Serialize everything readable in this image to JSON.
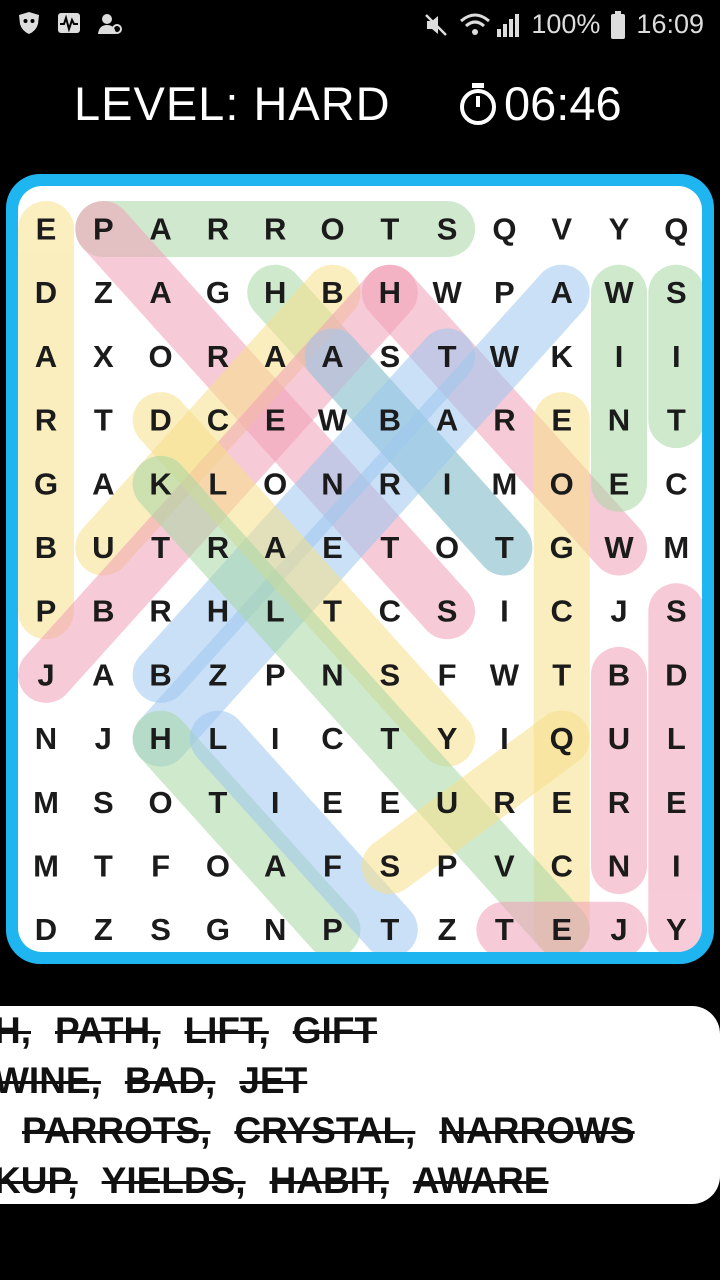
{
  "status": {
    "battery": "100%",
    "time": "16:09"
  },
  "header": {
    "level": "LEVEL: HARD",
    "timer": "06:46"
  },
  "grid": [
    [
      "E",
      "P",
      "A",
      "R",
      "R",
      "O",
      "T",
      "S",
      "Q",
      "V",
      "Y",
      "Q"
    ],
    [
      "D",
      "Z",
      "A",
      "G",
      "H",
      "B",
      "H",
      "W",
      "P",
      "A",
      "W",
      "S"
    ],
    [
      "A",
      "X",
      "O",
      "R",
      "A",
      "A",
      "S",
      "T",
      "W",
      "K",
      "I",
      "I"
    ],
    [
      "R",
      "T",
      "D",
      "C",
      "E",
      "W",
      "B",
      "A",
      "R",
      "E",
      "N",
      "T"
    ],
    [
      "G",
      "A",
      "K",
      "L",
      "O",
      "N",
      "R",
      "I",
      "M",
      "O",
      "E",
      "C"
    ],
    [
      "B",
      "U",
      "T",
      "R",
      "A",
      "E",
      "T",
      "O",
      "T",
      "G",
      "W",
      "M"
    ],
    [
      "P",
      "B",
      "R",
      "H",
      "L",
      "T",
      "C",
      "S",
      "I",
      "C",
      "J",
      "S"
    ],
    [
      "J",
      "A",
      "B",
      "Z",
      "P",
      "N",
      "S",
      "F",
      "W",
      "T",
      "B",
      "D"
    ],
    [
      "N",
      "J",
      "H",
      "L",
      "I",
      "C",
      "T",
      "Y",
      "I",
      "Q",
      "U",
      "L"
    ],
    [
      "M",
      "S",
      "O",
      "T",
      "I",
      "E",
      "E",
      "U",
      "R",
      "E",
      "R",
      "E"
    ],
    [
      "M",
      "T",
      "F",
      "O",
      "A",
      "F",
      "S",
      "P",
      "V",
      "C",
      "N",
      "I"
    ],
    [
      "D",
      "Z",
      "S",
      "G",
      "N",
      "P",
      "T",
      "Z",
      "T",
      "E",
      "J",
      "Y"
    ]
  ],
  "highlights": [
    {
      "from": [
        0,
        0
      ],
      "to": [
        6,
        0
      ],
      "color": "#f7e08a"
    },
    {
      "from": [
        0,
        1
      ],
      "to": [
        0,
        7
      ],
      "color": "#a9d8a6"
    },
    {
      "from": [
        0,
        1
      ],
      "to": [
        6,
        7
      ],
      "color": "#f2a0b8"
    },
    {
      "from": [
        1,
        4
      ],
      "to": [
        5,
        8
      ],
      "color": "#a9d8a6"
    },
    {
      "from": [
        1,
        5
      ],
      "to": [
        5,
        1
      ],
      "color": "#f7e08a"
    },
    {
      "from": [
        1,
        6
      ],
      "to": [
        7,
        0
      ],
      "color": "#f2a0b8"
    },
    {
      "from": [
        1,
        6
      ],
      "to": [
        5,
        10
      ],
      "color": "#f2a0b8"
    },
    {
      "from": [
        1,
        9
      ],
      "to": [
        8,
        2
      ],
      "color": "#9ec8ef"
    },
    {
      "from": [
        1,
        10
      ],
      "to": [
        4,
        10
      ],
      "color": "#a9d8a6"
    },
    {
      "from": [
        1,
        11
      ],
      "to": [
        3,
        11
      ],
      "color": "#a9d8a6"
    },
    {
      "from": [
        2,
        5
      ],
      "to": [
        5,
        8
      ],
      "color": "#9ec8ef"
    },
    {
      "from": [
        2,
        7
      ],
      "to": [
        7,
        2
      ],
      "color": "#9ec8ef"
    },
    {
      "from": [
        3,
        2
      ],
      "to": [
        8,
        7
      ],
      "color": "#f7e08a"
    },
    {
      "from": [
        3,
        9
      ],
      "to": [
        11,
        9
      ],
      "color": "#f7e08a"
    },
    {
      "from": [
        4,
        2
      ],
      "to": [
        11,
        9
      ],
      "color": "#a9d8a6"
    },
    {
      "from": [
        6,
        11
      ],
      "to": [
        11,
        11
      ],
      "color": "#f2a0b8"
    },
    {
      "from": [
        7,
        10
      ],
      "to": [
        10,
        10
      ],
      "color": "#f2a0b8"
    },
    {
      "from": [
        8,
        2
      ],
      "to": [
        11,
        5
      ],
      "color": "#a9d8a6"
    },
    {
      "from": [
        8,
        3
      ],
      "to": [
        11,
        6
      ],
      "color": "#9ec8ef"
    },
    {
      "from": [
        10,
        6
      ],
      "to": [
        8,
        9
      ],
      "color": "#f7e08a"
    },
    {
      "from": [
        11,
        8
      ],
      "to": [
        11,
        10
      ],
      "color": "#f2a0b8"
    }
  ],
  "words": [
    [
      "H,",
      "PATH,",
      "LIFT,",
      "GIFT"
    ],
    [
      "WINE,",
      "BAD,",
      "JET"
    ],
    [
      "",
      "PARROTS,",
      "CRYSTAL,",
      "NARROWS"
    ],
    [
      "KUP,",
      "YIELDS,",
      "HABIT,",
      "AWARE"
    ]
  ],
  "colors": {
    "frame": "#1fb5f0",
    "background": "#000000"
  }
}
